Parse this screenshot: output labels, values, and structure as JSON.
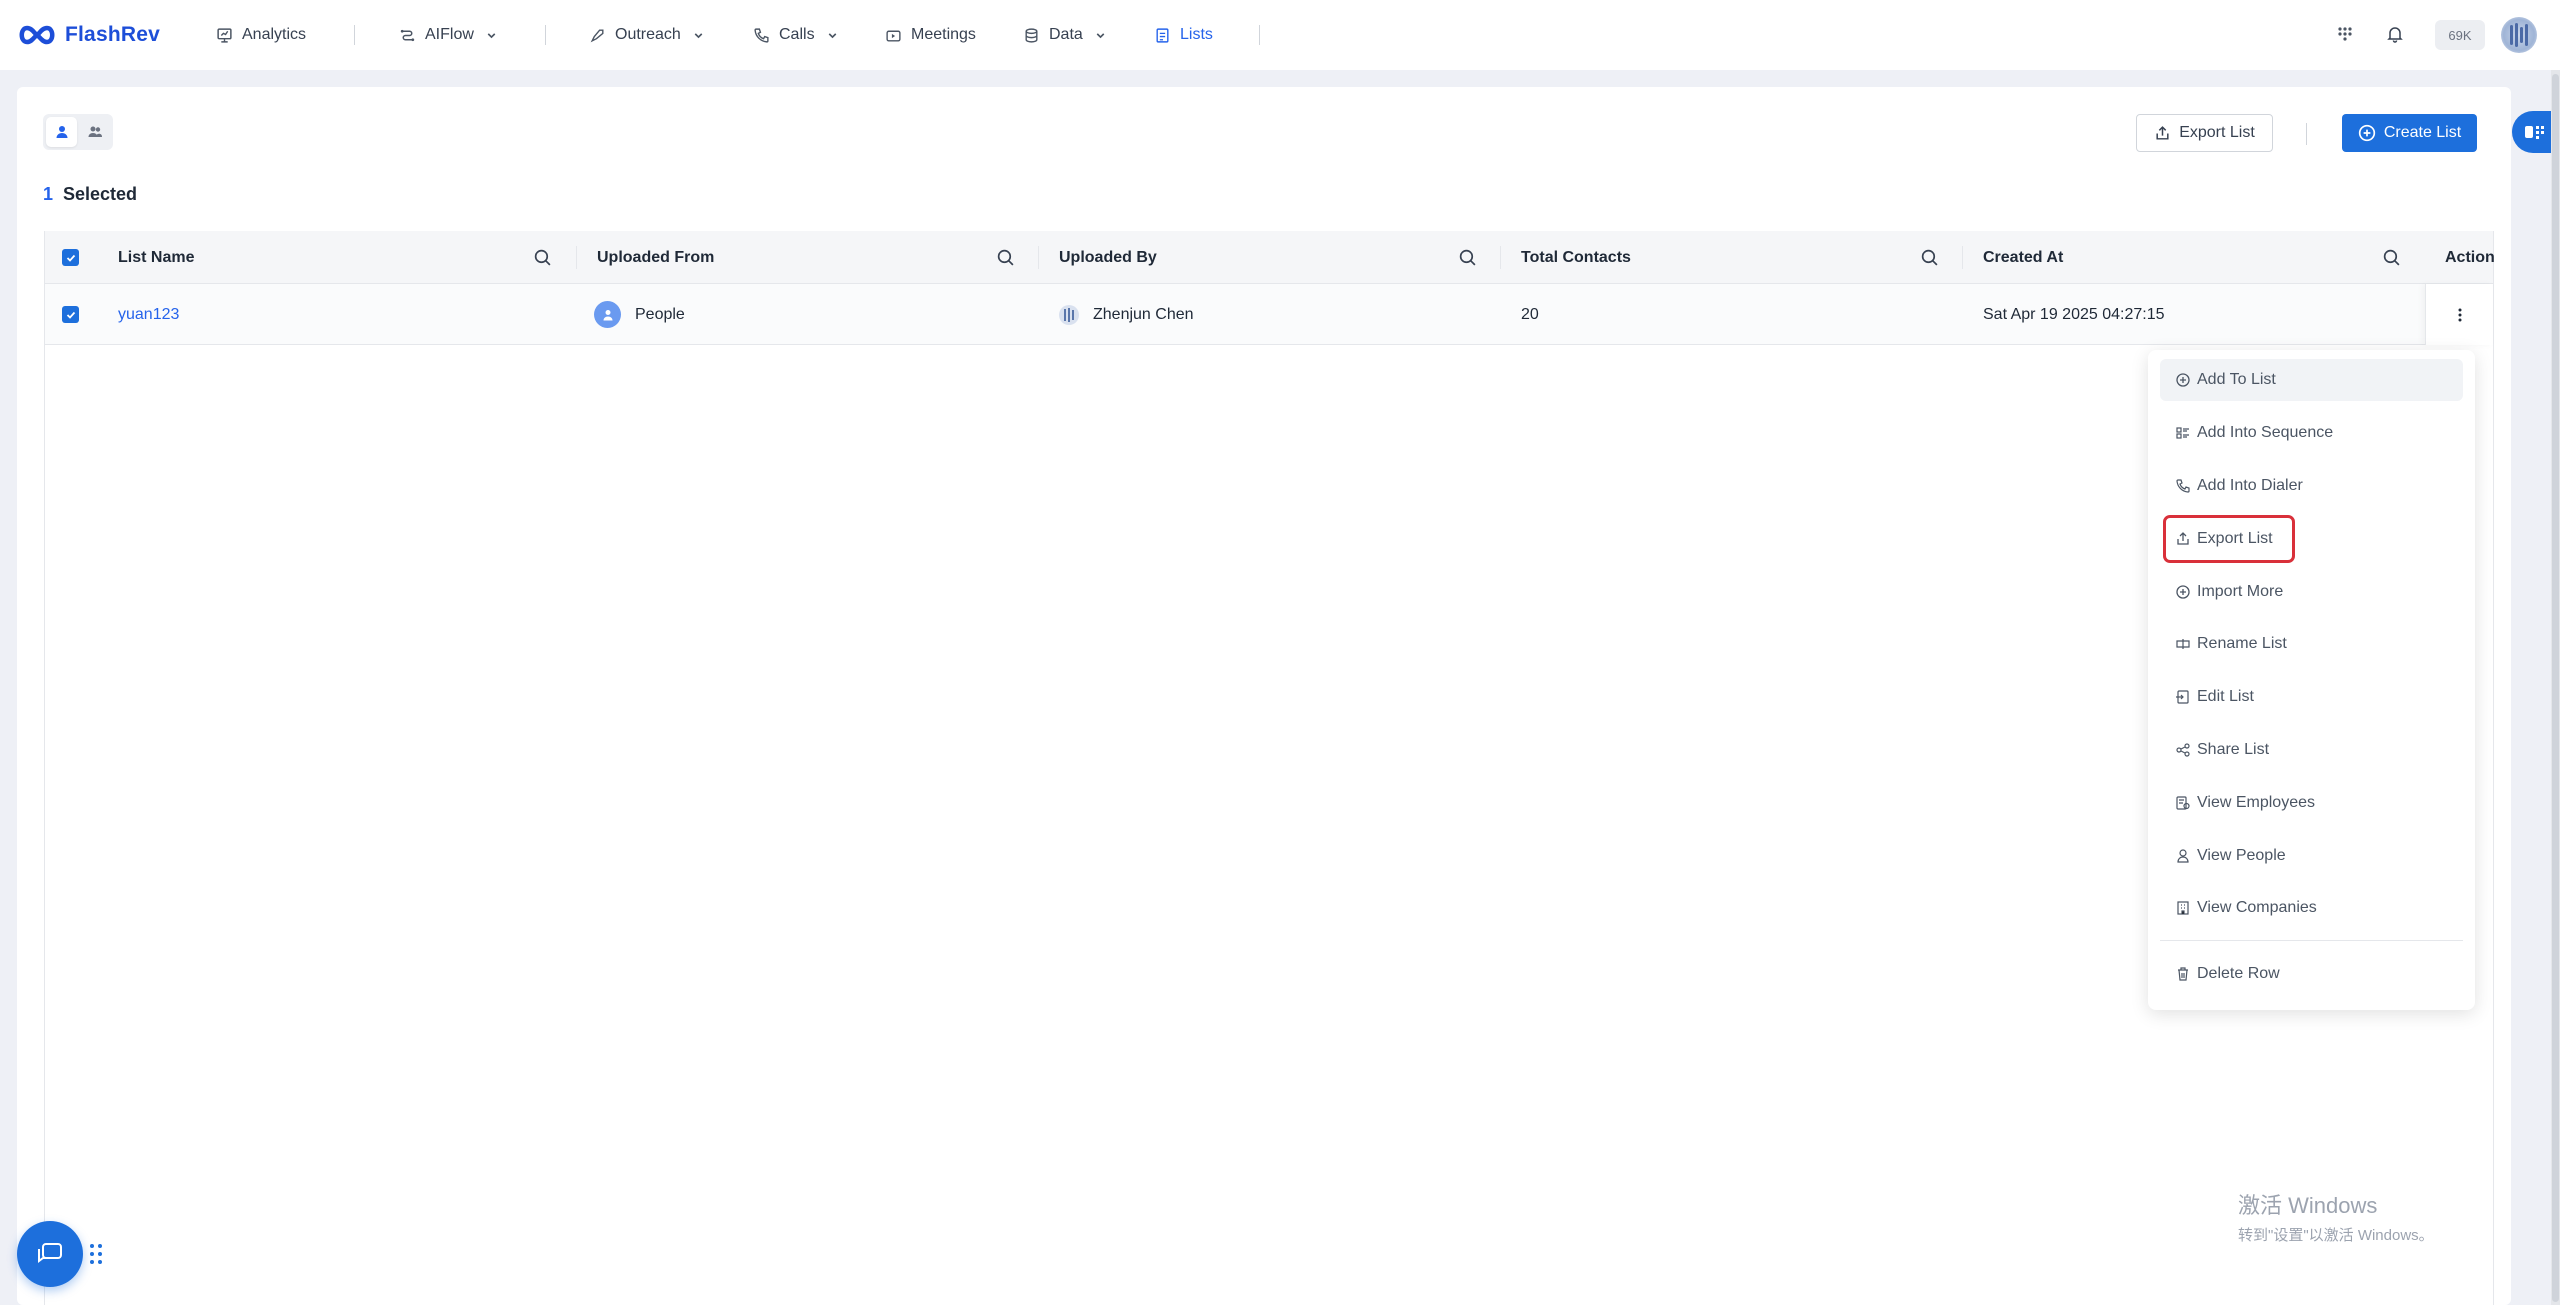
{
  "brand": {
    "name": "FlashRev"
  },
  "nav": {
    "items": [
      {
        "label": "Analytics",
        "icon": "chart-board-icon"
      },
      {
        "label": "AIFlow",
        "icon": "flow-icon"
      },
      {
        "label": "Outreach",
        "icon": "rocket-icon"
      },
      {
        "label": "Calls",
        "icon": "phone-icon"
      },
      {
        "label": "Meetings",
        "icon": "video-icon"
      },
      {
        "label": "Data",
        "icon": "database-icon"
      },
      {
        "label": "Lists",
        "icon": "list-doc-icon"
      }
    ],
    "active": "Lists",
    "credits": "69K"
  },
  "toolbar": {
    "export_label": "Export List",
    "create_label": "Create List"
  },
  "selection": {
    "count": "1",
    "label": "Selected"
  },
  "table": {
    "columns": [
      "List Name",
      "Uploaded From",
      "Uploaded By",
      "Total Contacts",
      "Created At",
      "Action"
    ],
    "rows": [
      {
        "list_name": "yuan123",
        "uploaded_from": "People",
        "uploaded_by": "Zhenjun Chen",
        "total_contacts": "20",
        "created_at": "Sat Apr 19 2025 04:27:15",
        "selected": true
      }
    ]
  },
  "action_menu": {
    "items": [
      {
        "label": "Add To List",
        "icon": "plus-circle-icon"
      },
      {
        "label": "Add Into Sequence",
        "icon": "sequence-icon"
      },
      {
        "label": "Add Into Dialer",
        "icon": "phone-icon"
      },
      {
        "label": "Export List",
        "icon": "export-icon"
      },
      {
        "label": "Import More",
        "icon": "plus-circle-icon"
      },
      {
        "label": "Rename List",
        "icon": "rename-icon"
      },
      {
        "label": "Edit List",
        "icon": "edit-icon"
      },
      {
        "label": "Share List",
        "icon": "share-icon"
      },
      {
        "label": "View Employees",
        "icon": "employees-icon"
      },
      {
        "label": "View People",
        "icon": "person-icon"
      },
      {
        "label": "View Companies",
        "icon": "building-icon"
      },
      {
        "label": "Delete Row",
        "icon": "trash-icon"
      }
    ],
    "hovered": "Add To List",
    "highlighted": "Export List"
  },
  "watermark": {
    "line1": "激活 Windows",
    "line2": "转到\"设置\"以激活 Windows。"
  },
  "colors": {
    "primary": "#1d6fdc",
    "link": "#2563eb",
    "highlight_outline": "#d9303a",
    "page_bg": "#eef0f6"
  }
}
